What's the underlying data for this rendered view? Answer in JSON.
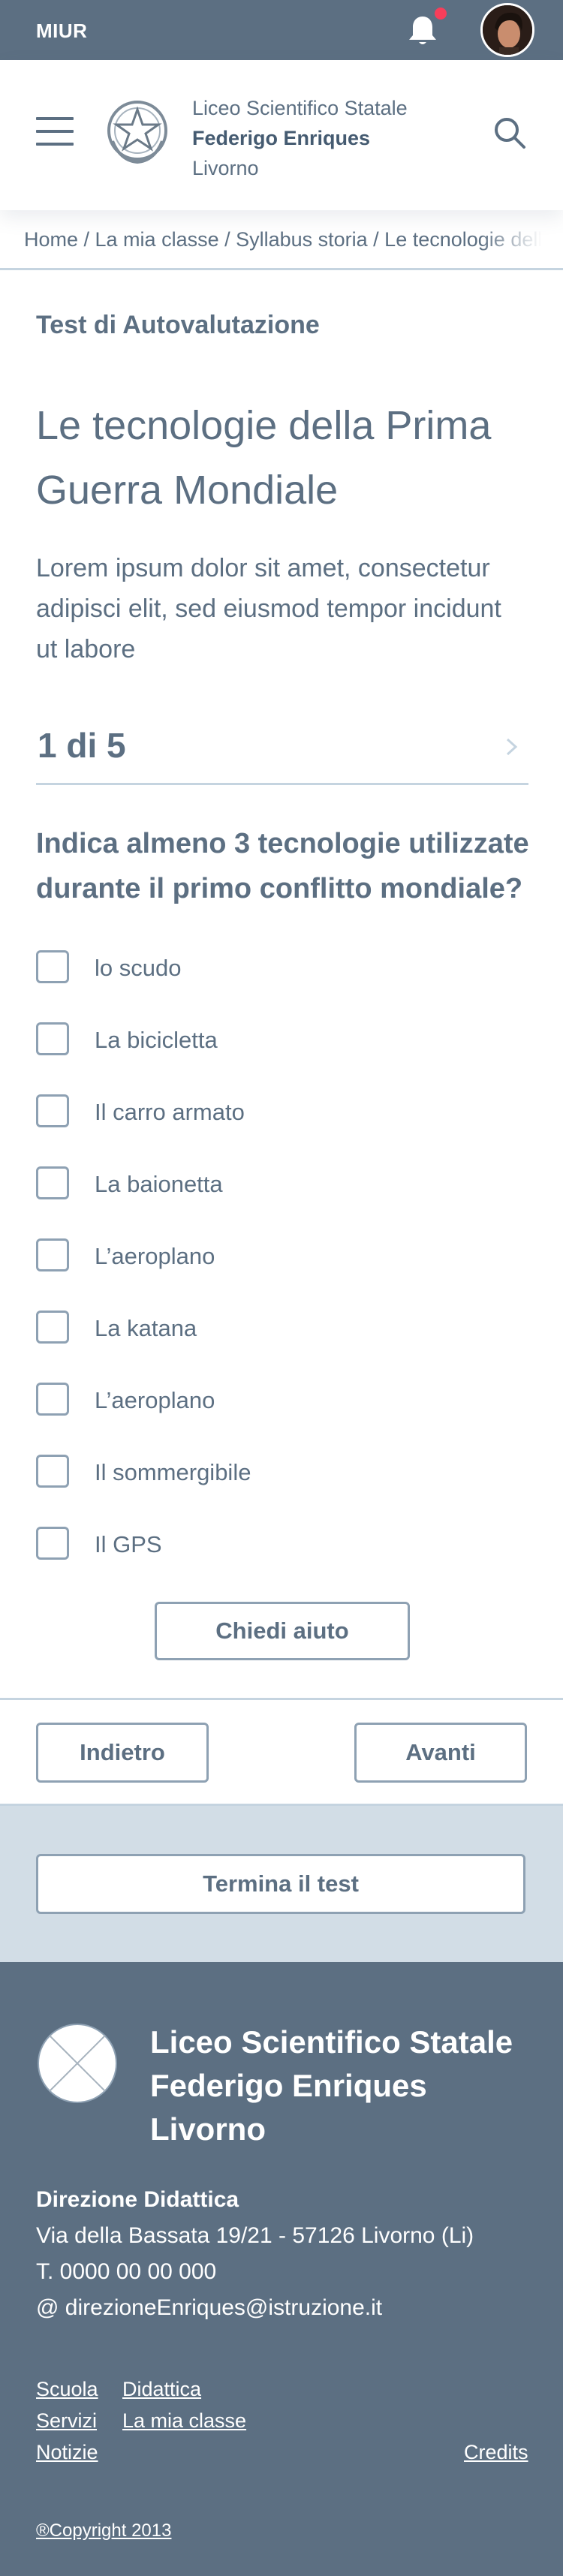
{
  "topbar": {
    "brand": "MIUR",
    "notification_indicator": true,
    "bg_color": "#5c6f82",
    "badge_color": "#f73e5a"
  },
  "header": {
    "school_line1": "Liceo Scientifico Statale",
    "school_line2": "Federigo Enriques",
    "school_line3": "Livorno",
    "menu_icon": "hamburger-menu-icon",
    "search_icon": "search-icon",
    "emblem_icon": "republic-emblem-icon"
  },
  "breadcrumb": "Home / La mia classe / Syllabus storia / Le tecnologie della Prima Guerra Mondiale",
  "main": {
    "kicker": "Test di Autovalutazione",
    "title": "Le tecnologie della Prima Guerra Mondiale",
    "lead": "Lorem ipsum dolor sit amet, consectetur adipisci elit, sed eiusmod tempor incidunt ut labore",
    "pager": "1 di 5",
    "question": "Indica almeno 3 tecnologie utilizzate durante il primo conflitto mondiale?",
    "options": [
      {
        "label": "lo scudo",
        "checked": false
      },
      {
        "label": "La bicicletta",
        "checked": false
      },
      {
        "label": "Il carro armato",
        "checked": false
      },
      {
        "label": "La baionetta",
        "checked": false
      },
      {
        "label": "L’aeroplano",
        "checked": false
      },
      {
        "label": "La katana",
        "checked": false
      },
      {
        "label": "L’aeroplano",
        "checked": false
      },
      {
        "label": "Il sommergibile",
        "checked": false
      },
      {
        "label": "Il GPS",
        "checked": false
      }
    ],
    "help_button": "Chiedi aiuto"
  },
  "navigation": {
    "back_label": "Indietro",
    "next_label": "Avanti",
    "end_label": "Termina il test"
  },
  "footer": {
    "name_line1": "Liceo Scientifico Statale",
    "name_line2": "Federigo Enriques",
    "name_line3": "Livorno",
    "heading": "Direzione Didattica",
    "address": "Via della Bassata 19/21 - 57126 Livorno (Li)",
    "phone": "T. 0000 00 00 000",
    "email": "@ direzioneEnriques@istruzione.it",
    "links": {
      "scuola": "Scuola",
      "didattica": "Didattica",
      "servizi": "Servizi",
      "mia_classe": "La mia classe",
      "notizie": "Notizie",
      "credits": "Credits"
    },
    "copyright": "®Copyright 2013"
  }
}
